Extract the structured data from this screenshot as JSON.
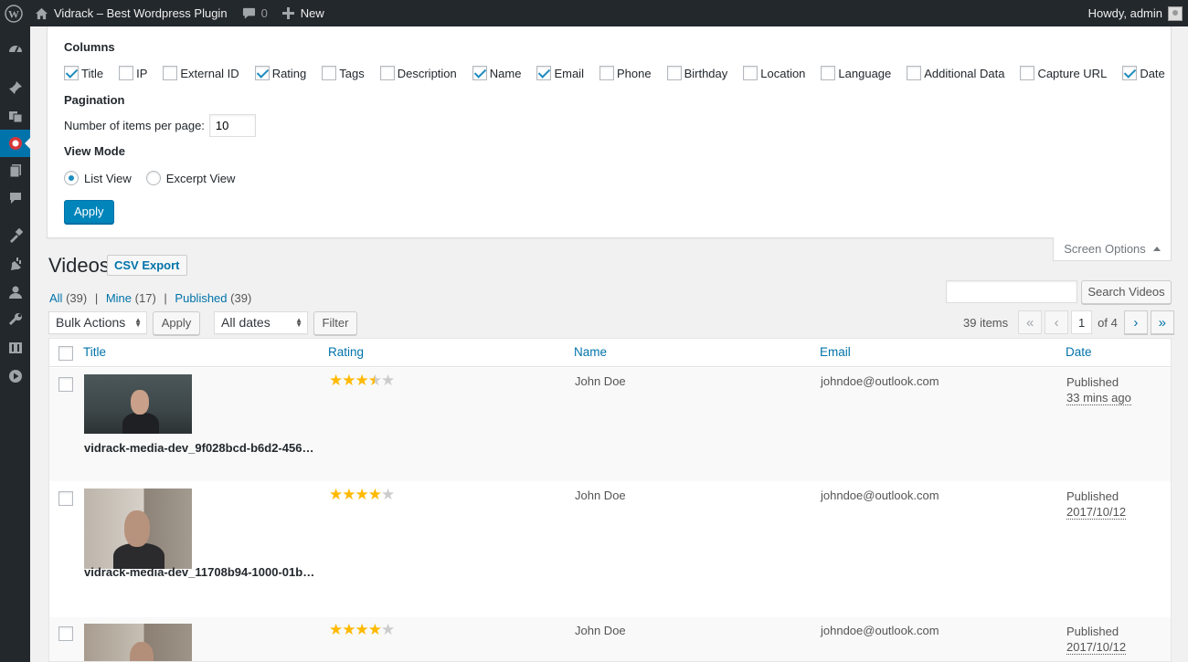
{
  "admin_bar": {
    "site_name": "Vidrack – Best Wordpress Plugin",
    "comments_count": "0",
    "new_label": "New",
    "howdy": "Howdy, admin"
  },
  "sidebar": {
    "icons": [
      "dashboard-icon",
      "posts-pin-icon",
      "media-icon",
      "vidrack-icon",
      "pages-icon",
      "comments-icon",
      "appearance-icon",
      "plugins-icon",
      "users-icon",
      "tools-icon",
      "settings-icon",
      "video-play-icon"
    ],
    "active": "vidrack-icon"
  },
  "screen_options": {
    "columns_heading": "Columns",
    "columns": [
      {
        "label": "Title",
        "checked": true
      },
      {
        "label": "IP",
        "checked": false
      },
      {
        "label": "External ID",
        "checked": false
      },
      {
        "label": "Rating",
        "checked": true
      },
      {
        "label": "Tags",
        "checked": false
      },
      {
        "label": "Description",
        "checked": false
      },
      {
        "label": "Name",
        "checked": true
      },
      {
        "label": "Email",
        "checked": true
      },
      {
        "label": "Phone",
        "checked": false
      },
      {
        "label": "Birthday",
        "checked": false
      },
      {
        "label": "Location",
        "checked": false
      },
      {
        "label": "Language",
        "checked": false
      },
      {
        "label": "Additional Data",
        "checked": false
      },
      {
        "label": "Capture URL",
        "checked": false
      },
      {
        "label": "Date",
        "checked": true
      }
    ],
    "pagination_heading": "Pagination",
    "per_page_label": "Number of items per page:",
    "per_page_value": "10",
    "view_mode_heading": "View Mode",
    "view_modes": [
      {
        "label": "List View",
        "selected": true
      },
      {
        "label": "Excerpt View",
        "selected": false
      }
    ],
    "apply_label": "Apply",
    "toggle_label": "Screen Options"
  },
  "page": {
    "title": "Videos",
    "csv_export": "CSV Export",
    "filters": {
      "all": "All",
      "all_count": "(39)",
      "mine": "Mine",
      "mine_count": "(17)",
      "published": "Published",
      "published_count": "(39)"
    },
    "search_button": "Search Videos",
    "bulk_actions": "Bulk Actions",
    "apply": "Apply",
    "all_dates": "All dates",
    "filter": "Filter",
    "items_count": "39 items",
    "current_page": "1",
    "of_pages": "of 4"
  },
  "table": {
    "headers": [
      "Title",
      "Rating",
      "Name",
      "Email",
      "Date"
    ],
    "rows": [
      {
        "filename": "vidrack-media-dev_9f028bcd-b6d2-456…",
        "rating": 3.5,
        "name": "John Doe",
        "email": "johndoe@outlook.com",
        "status": "Published",
        "date": "33 mins ago"
      },
      {
        "filename": "vidrack-media-dev_11708b94-1000-01b…",
        "rating": 4,
        "name": "John Doe",
        "email": "johndoe@outlook.com",
        "status": "Published",
        "date": "2017/10/12"
      },
      {
        "filename": "",
        "rating": 4,
        "name": "John Doe",
        "email": "johndoe@outlook.com",
        "status": "Published",
        "date": "2017/10/12"
      }
    ]
  },
  "colors": {
    "admin_bar_bg": "#23282d",
    "accent": "#0073aa",
    "primary_button": "#0085ba",
    "star": "#ffb900"
  }
}
